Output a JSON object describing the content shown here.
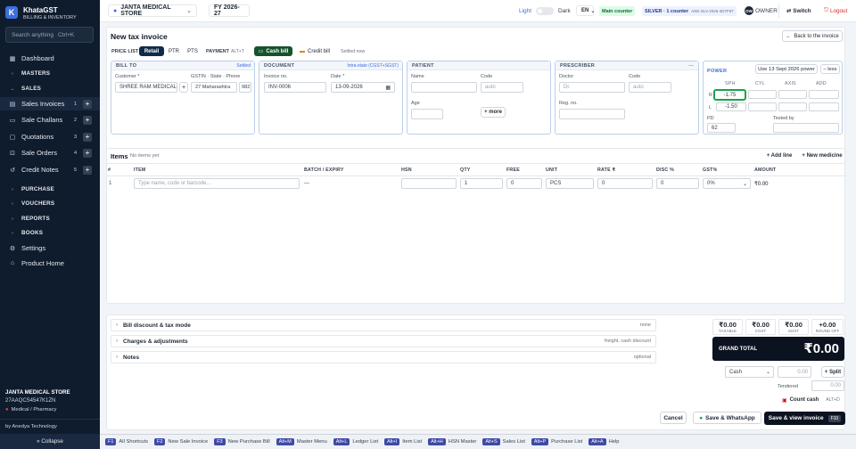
{
  "app": {
    "name": "KhataGST",
    "tagline": "BILLING & INVENTORY",
    "logo": "K"
  },
  "sidebar": {
    "search_placeholder": "Search anything",
    "search_shortcut": "Ctrl+K",
    "items": [
      {
        "label": "Dashboard"
      },
      {
        "label": "MASTERS"
      },
      {
        "label": "SALES"
      },
      {
        "label": "Sales Invoices",
        "count": "1"
      },
      {
        "label": "Sale Challans",
        "count": "2"
      },
      {
        "label": "Quotations",
        "count": "3"
      },
      {
        "label": "Sale Orders",
        "count": "4"
      },
      {
        "label": "Credit Notes",
        "count": "5"
      },
      {
        "label": "PURCHASE"
      },
      {
        "label": "VOUCHERS"
      },
      {
        "label": "REPORTS"
      },
      {
        "label": "BOOKS"
      },
      {
        "label": "Settings"
      },
      {
        "label": "Product Home"
      }
    ],
    "company_name": "JANTA MEDICAL STORE",
    "company_gstin": "27AAQCS4547K1ZN",
    "company_type": "Medical / Pharmacy",
    "vendor": "by Anedya Technology",
    "collapse_label": "« Collapse"
  },
  "topbar": {
    "company": "JANTA MEDICAL STORE",
    "fy": "FY 2026-27",
    "theme_light": "Light",
    "theme_dark": "Dark",
    "lang": "EN",
    "counter": "Main counter",
    "plan": "SILVER · 1 counter",
    "plan_code": "ANE-SLV-2026-4D7F87",
    "avatar": "OW",
    "role": "OWNER",
    "switch": "Switch",
    "logout": "Logout"
  },
  "invoice": {
    "title": "New tax invoice",
    "back": "Back to the invoice",
    "price_list_label": "PRICE LIST",
    "price_lists": [
      "Retail",
      "PTR",
      "PTS"
    ],
    "payment_label": "PAYMENT",
    "payment_shortcut": "ALT+T",
    "cash_bill": "Cash bill",
    "credit_bill": "Credit bill",
    "settled_now": "Settled now",
    "bill_to": {
      "heading": "BILL TO",
      "settled": "Settled",
      "customer_label": "Customer *",
      "customer": "SHREE RAM MEDICAL",
      "gstin_label": "GSTIN · State · Phone",
      "state": "27 Maharashtra",
      "phone": "982"
    },
    "document": {
      "heading": "DOCUMENT",
      "tax_mode": "Intra-state (CGST+SGST)",
      "invoice_no_label": "Invoice no.",
      "invoice_no": "INV-0006",
      "date_label": "Date *",
      "date": "13-09-2026"
    },
    "patient": {
      "heading": "PATIENT",
      "name_label": "Name",
      "code_label": "Code",
      "code_placeholder": "auto",
      "age_label": "Age",
      "more": "+ more"
    },
    "prescriber": {
      "heading": "PRESCRIBER",
      "doctor_label": "Doctor",
      "doctor_placeholder": "Dr.",
      "code_label": "Code",
      "code_placeholder": "auto",
      "reg_label": "Reg. no."
    },
    "power": {
      "heading": "POWER",
      "use_btn": "Use 13 Sept 2026 power",
      "less": "– less",
      "cols": [
        "SPH",
        "CYL",
        "AXIS",
        "ADD"
      ],
      "r_label": "R",
      "r_sph": "-1.75",
      "l_label": "L",
      "l_sph": "-1.50",
      "pd_label": "PD",
      "pd": "62",
      "tested_label": "Tested by"
    }
  },
  "items": {
    "title": "Items",
    "empty": "No items yet",
    "add_line": "+ Add line",
    "new_medicine": "+ New medicine",
    "headers": [
      "#",
      "ITEM",
      "BATCH / EXPIRY",
      "HSN",
      "QTY",
      "FREE",
      "UNIT",
      "RATE ₹",
      "DISC %",
      "GST%",
      "AMOUNT"
    ],
    "row": {
      "index": "1",
      "item_placeholder": "Type name, code or barcode...",
      "batch": "—",
      "qty": "1",
      "free": "0",
      "unit": "PCS",
      "rate": "0",
      "disc": "0",
      "gst": "0%",
      "amount": "₹0.00"
    }
  },
  "summary": {
    "sections": [
      {
        "label": "Bill discount & tax mode",
        "hint": "none"
      },
      {
        "label": "Charges & adjustments",
        "hint": "freight, cash discount"
      },
      {
        "label": "Notes",
        "hint": "optional"
      }
    ],
    "totals": [
      {
        "value": "₹0.00",
        "label": "TAXABLE"
      },
      {
        "value": "₹0.00",
        "label": "CGST"
      },
      {
        "value": "₹0.00",
        "label": "SGST"
      },
      {
        "value": "+0.00",
        "label": "ROUND OFF"
      }
    ],
    "grand_total_label": "GRAND TOTAL",
    "grand_total": "₹0.00",
    "pay_mode": "Cash",
    "pay_amount": "0.00",
    "split": "+ Split",
    "tendered_label": "Tendered",
    "tendered": "0.00",
    "count_cash": "Count cash",
    "count_cash_shortcut": "ALT+D",
    "cancel": "Cancel",
    "save_whatsapp": "Save & WhatsApp",
    "save_view": "Save & view invoice",
    "save_view_shortcut": "F10"
  },
  "shortcuts": [
    {
      "key": "F1",
      "label": "All Shortcuts"
    },
    {
      "key": "F2",
      "label": "New Sale Invoice"
    },
    {
      "key": "F3",
      "label": "New Purchase Bill"
    },
    {
      "key": "Alt+M",
      "label": "Master Menu"
    },
    {
      "key": "Alt+L",
      "label": "Ledger List"
    },
    {
      "key": "Alt+I",
      "label": "Item List"
    },
    {
      "key": "Alt+H",
      "label": "HSN Master"
    },
    {
      "key": "Alt+S",
      "label": "Sales List"
    },
    {
      "key": "Alt+P",
      "label": "Purchase List"
    },
    {
      "key": "Alt+A",
      "label": "Help"
    }
  ],
  "colors": {
    "sidebar": "#0f1c2e",
    "accent": "#3b6fe0",
    "cash_bill": "#14532d",
    "grand_total": "#0b1220",
    "highlight": "#16a34a"
  }
}
